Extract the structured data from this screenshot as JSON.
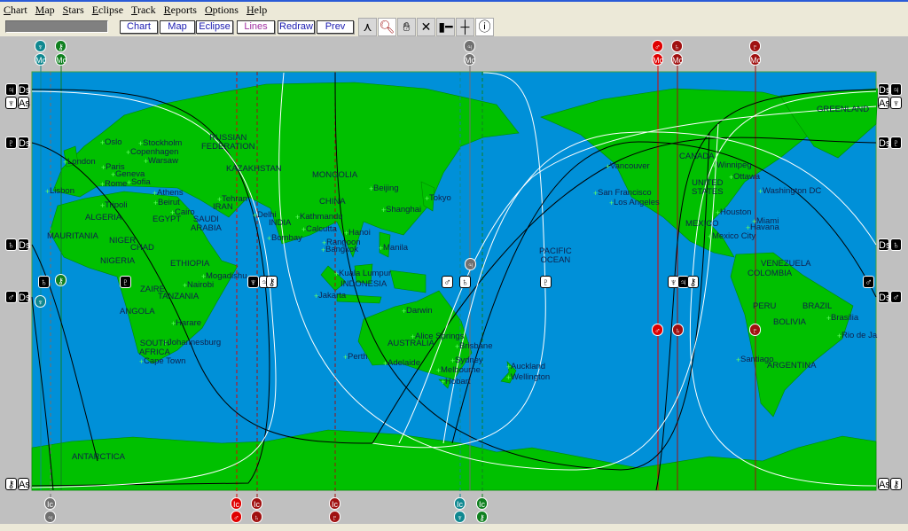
{
  "menu": [
    "Chart",
    "Map",
    "Stars",
    "Eclipse",
    "Track",
    "Reports",
    "Options",
    "Help"
  ],
  "toolbar": {
    "status": "",
    "buttons": [
      "Chart",
      "Map",
      "Eclipse",
      "Lines",
      "Redraw",
      "Prev"
    ],
    "icons": [
      "person-icon",
      "zoom-icon",
      "pan-hand-icon",
      "cross-icon",
      "slider-icon",
      "crosshair-icon",
      "info-icon"
    ]
  },
  "colors": {
    "ocean": "#0090d8",
    "land": "#00c000",
    "mars": "#e00000",
    "darkred": "#a01010",
    "neptune": "#108890",
    "chiron": "#108020",
    "jupiter": "#707070"
  },
  "top_markers": [
    {
      "planet": "♆",
      "angle": "Mc",
      "color": "#108890"
    },
    {
      "planet": "⚷",
      "angle": "Mc",
      "color": "#108020"
    },
    {
      "planet": "♃",
      "angle": "Mc",
      "color": "#707070"
    },
    {
      "planet": "♂",
      "angle": "Mc",
      "color": "#e00000"
    },
    {
      "planet": "♄",
      "angle": "Mc",
      "color": "#a01010"
    },
    {
      "planet": "♇",
      "angle": "Mc",
      "color": "#a01010"
    }
  ],
  "bottom_markers": [
    {
      "planet": "♃",
      "angle": "Ic",
      "color": "#707070"
    },
    {
      "planet": "♂",
      "angle": "Ic",
      "color": "#e00000"
    },
    {
      "planet": "♄",
      "angle": "Ic",
      "color": "#a01010"
    },
    {
      "planet": "♇",
      "angle": "Ic",
      "color": "#a01010"
    },
    {
      "planet": "♆",
      "angle": "Ic",
      "color": "#108890"
    },
    {
      "planet": "⚷",
      "angle": "Ic",
      "color": "#108020"
    }
  ],
  "side_labels": [
    {
      "planet": "♃",
      "angle": "Ds"
    },
    {
      "planet": "♆",
      "angle": "As"
    },
    {
      "planet": "♇",
      "angle": "Ds"
    },
    {
      "planet": "♄",
      "angle": "Ds"
    },
    {
      "planet": "♂",
      "angle": "Ds"
    },
    {
      "planet": "⚷",
      "angle": "As"
    }
  ],
  "map_glyphs": [
    "♄",
    "⚷",
    "♇",
    "♆",
    "♃",
    "⚷",
    "♂",
    "♄",
    "♇",
    "♆",
    "♃",
    "⚷",
    "♂",
    "♃",
    "♆",
    "♂",
    "♄",
    "♇"
  ],
  "cities": [
    "Oslo",
    "Stockholm",
    "Copenhagen",
    "Warsaw",
    "London",
    "Paris",
    "Geneva",
    "Rome",
    "Sofia",
    "Lisbon",
    "Athens",
    "Beirut",
    "Cairo",
    "Tripoli",
    "Tehran",
    "Delhi",
    "Kathmandu",
    "Calcutta",
    "Hanoi",
    "Bombay",
    "Rangoon",
    "Bangkok",
    "Beijing",
    "Shanghai",
    "Tokyo",
    "Manila",
    "Kuala Lumpur",
    "Jakarta",
    "Mogadishu",
    "Nairobi",
    "Harare",
    "Johannesburg",
    "Cape Town",
    "Darwin",
    "Alice Springs",
    "Brisbane",
    "Perth",
    "Adelaide",
    "Sydney",
    "Melbourne",
    "Hobart",
    "Auckland",
    "Wellington",
    "Vancouver",
    "San Francisco",
    "Los Angeles",
    "Winnipeg",
    "Ottawa",
    "Washington DC",
    "Houston",
    "Miami",
    "Havana",
    "Mexico City",
    "Brasilia",
    "Rio de Ja",
    "Santiago"
  ],
  "regions": [
    "RUSSIAN\nFEDERATION",
    "KAZAKHSTAN",
    "MONGOLIA",
    "CHINA",
    "INDIA",
    "IRAN",
    "ALGERIA",
    "EGYPT",
    "SAUDI\nARABIA",
    "MAURITANIA",
    "NIGER",
    "CHAD",
    "NIGERIA",
    "ETHIOPIA",
    "ZAIRE",
    "TANZANIA",
    "ANGOLA",
    "SOUTH\nAFRICA",
    "INDONESIA",
    "AUSTRALIA",
    "PACIFIC\nOCEAN",
    "CANADA",
    "UNITED\nSTATES",
    "MEXICO",
    "VENEZUELA",
    "COLOMBIA",
    "PERU",
    "BOLIVIA",
    "BRAZIL",
    "ARGENTINA",
    "GREENLAND",
    "ANTARCTICA"
  ]
}
